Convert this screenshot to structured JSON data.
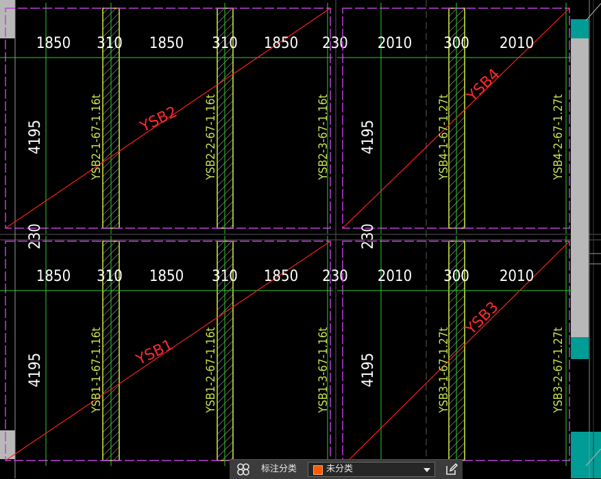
{
  "colors": {
    "background": "#000000",
    "panel_border": "#c040e0",
    "axis_green": "#30d030",
    "diagonal_red": "#ff2020",
    "beam_yellow": "#d8f040",
    "label_yellow": "#c8e650",
    "edge_teal": "#009c96",
    "edge_grey": "#b8b8b8"
  },
  "panels": [
    {
      "id": "top-left",
      "dims_h": [
        "1850",
        "310",
        "1850",
        "310",
        "1850",
        "230"
      ],
      "dim_v": "4195",
      "labels": [
        "YSB2-1-67-1.16t",
        "YSB2-2-67-1.16t",
        "YSB2-3-67-1.16t"
      ],
      "diagonal": "YSB2"
    },
    {
      "id": "top-right",
      "dims_h": [
        "2010",
        "300",
        "2010"
      ],
      "dim_v": "4195",
      "labels": [
        "YSB4-1-67-1.27t",
        "YSB4-2-67-1.27t"
      ],
      "diagonal": "YSB4"
    },
    {
      "id": "bottom-left",
      "dims_h": [
        "1850",
        "310",
        "1850",
        "310",
        "1850",
        "230"
      ],
      "dim_v": "4195",
      "labels": [
        "YSB1-1-67-1.16t",
        "YSB1-2-67-1.16t",
        "YSB1-3-67-1.16t"
      ],
      "diagonal": "YSB1"
    },
    {
      "id": "bottom-right",
      "dims_h": [
        "2010",
        "300",
        "2010"
      ],
      "dim_v": "4195",
      "labels": [
        "YSB3-1-67-1.27t",
        "YSB3-2-67-1.27t"
      ],
      "diagonal": "YSB3"
    }
  ],
  "gap_dims": {
    "left_top": "230",
    "center_top": "230"
  },
  "toolbar": {
    "group_icon": "grid-group-icon",
    "label": "标注分类",
    "select_value": "未分类",
    "select_color": "#ff5a00",
    "dropdown_icon": "chevron-down-icon",
    "edit_icon": "edit-pencil-icon"
  }
}
